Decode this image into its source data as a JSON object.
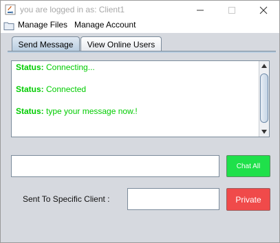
{
  "window": {
    "title": "you are logged in as: Client1",
    "app_icon": "java-cup-icon",
    "controls": [
      "minimize-icon",
      "maximize-icon",
      "close-icon"
    ]
  },
  "menu": {
    "folder_icon": "folder-icon",
    "items": [
      {
        "label": "Manage Files"
      },
      {
        "label": "Manage Account"
      }
    ]
  },
  "tabs": [
    {
      "label": "Send Message",
      "selected": true
    },
    {
      "label": "View Online Users",
      "selected": false
    }
  ],
  "log": {
    "lines": [
      {
        "prefix": "Status:",
        "text": " Connecting..."
      },
      {
        "prefix": "Status:",
        "text": " Connected"
      },
      {
        "prefix": "Status:",
        "text": " type your message now.!"
      }
    ]
  },
  "compose": {
    "message_value": "",
    "chat_all_label": "Chat All",
    "specific_label": "Sent To Specific Client :",
    "client_value": "",
    "private_label": "Private"
  },
  "colors": {
    "status_text": "#00cc00",
    "chat_all_bg": "#1fe04a",
    "private_bg": "#f04a4a",
    "tab_selected_bg": "#b8cde0",
    "window_bg": "#d6d9df"
  }
}
